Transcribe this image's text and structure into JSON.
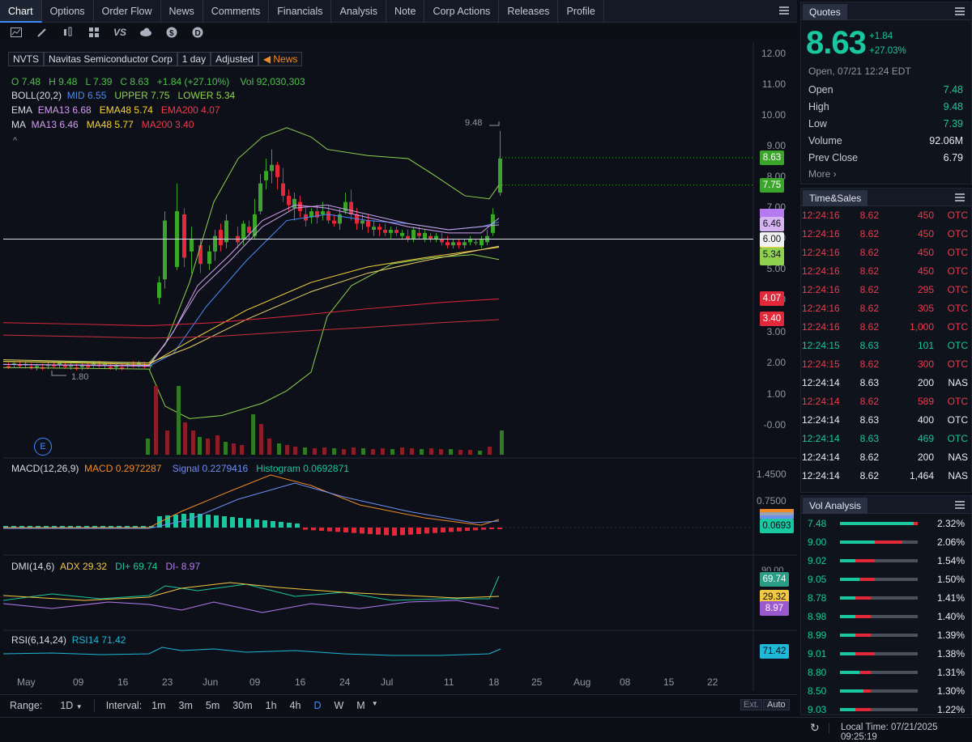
{
  "tabs": [
    "Chart",
    "Options",
    "Order Flow",
    "News",
    "Comments",
    "Financials",
    "Analysis",
    "Note",
    "Corp Actions",
    "Releases",
    "Profile"
  ],
  "toolbar_icons": [
    "line-chart-icon",
    "pen-icon",
    "candles-icon",
    "grid-icon",
    "compare-icon",
    "cloud-icon",
    "dollar-icon",
    "dividend-icon"
  ],
  "toolbar_vs": "VS",
  "header": {
    "symbol": "NVTS",
    "name": "Navitas Semiconductor Corp",
    "interval": "1 day",
    "adjust": "Adjusted",
    "news": "News"
  },
  "ohlc": {
    "o_label": "O",
    "o": "7.48",
    "h_label": "H",
    "h": "9.48",
    "l_label": "L",
    "l": "7.39",
    "c_label": "C",
    "c": "8.63",
    "chg": "+1.84 (+27.10%)",
    "vol_label": "Vol",
    "vol": "92,030,303"
  },
  "boll": {
    "name": "BOLL(20,2)",
    "mid": "MID 6.55",
    "upper": "UPPER 7.75",
    "lower": "LOWER 5.34"
  },
  "ema": {
    "name": "EMA",
    "e13": "EMA13 6.68",
    "e48": "EMA48 5.74",
    "e200": "EMA200 4.07"
  },
  "ma": {
    "name": "MA",
    "m13": "MA13 6.46",
    "m48": "MA48 5.77",
    "m200": "MA200 3.40"
  },
  "y_axis": [
    "12.00",
    "11.00",
    "10.00",
    "9.00",
    "8.00",
    "7.00",
    "6.00",
    "5.00",
    "4.00",
    "3.00",
    "2.00",
    "1.00",
    "-0.00"
  ],
  "price_labels": {
    "close": "8.63",
    "upper": "7.75",
    "ma13": "6.46",
    "cursor": "6.00",
    "lower": "5.34",
    "ema200": "4.07",
    "ma200": "3.40"
  },
  "high_marker": "9.48",
  "low_marker": "1.80",
  "earnings": "E",
  "macd": {
    "name": "MACD(12,26,9)",
    "macd": "MACD 0.2972287",
    "signal": "Signal 0.2279416",
    "hist": "Histogram 0.0692871",
    "axis": [
      "1.4500",
      "0.7500"
    ],
    "label": "0.0693"
  },
  "dmi": {
    "name": "DMI(14,6)",
    "adx": "ADX 29.32",
    "dip": "DI+ 69.74",
    "dim": "DI- 8.97",
    "lbl_dip": "69.74",
    "lbl_adx": "29.32",
    "lbl_dim": "8.97",
    "axis_top": "90.00"
  },
  "rsi": {
    "name": "RSI(6,14,24)",
    "rsi14": "RSI14 71.42",
    "lbl": "71.42"
  },
  "x_axis": [
    "May",
    "09",
    "16",
    "23",
    "Jun",
    "09",
    "16",
    "24",
    "Jul",
    "11",
    "18",
    "25",
    "Aug",
    "08",
    "15",
    "22"
  ],
  "bottom": {
    "range_label": "Range:",
    "range": "1D",
    "interval_label": "Interval:",
    "intervals": [
      "1m",
      "3m",
      "5m",
      "30m",
      "1h",
      "4h",
      "D",
      "W",
      "M"
    ],
    "ext": "Ext.",
    "auto": "Auto"
  },
  "status": {
    "local_time": "Local Time: 07/21/2025 09:25:19"
  },
  "quotes": {
    "title": "Quotes",
    "price": "8.63",
    "chg": "+1.84",
    "pct": "+27.03%",
    "time": "Open, 07/21 12:24 EDT",
    "rows": [
      [
        "Open",
        "7.48"
      ],
      [
        "High",
        "9.48"
      ],
      [
        "Low",
        "7.39"
      ],
      [
        "Volume",
        "92.06M"
      ],
      [
        "Prev Close",
        "6.79"
      ]
    ],
    "more": "More ›"
  },
  "timesales": {
    "title": "Time&Sales",
    "rows": [
      [
        "12:24:16",
        "8.62",
        "450",
        "OTC",
        "neg"
      ],
      [
        "12:24:16",
        "8.62",
        "450",
        "OTC",
        "neg"
      ],
      [
        "12:24:16",
        "8.62",
        "450",
        "OTC",
        "neg"
      ],
      [
        "12:24:16",
        "8.62",
        "450",
        "OTC",
        "neg"
      ],
      [
        "12:24:16",
        "8.62",
        "295",
        "OTC",
        "neg"
      ],
      [
        "12:24:16",
        "8.62",
        "305",
        "OTC",
        "neg"
      ],
      [
        "12:24:16",
        "8.62",
        "1,000",
        "OTC",
        "neg"
      ],
      [
        "12:24:15",
        "8.63",
        "101",
        "OTC",
        "pos"
      ],
      [
        "12:24:15",
        "8.62",
        "300",
        "OTC",
        "neg"
      ],
      [
        "12:24:14",
        "8.63",
        "200",
        "NAS",
        "wht"
      ],
      [
        "12:24:14",
        "8.62",
        "589",
        "OTC",
        "neg"
      ],
      [
        "12:24:14",
        "8.63",
        "400",
        "OTC",
        "wht"
      ],
      [
        "12:24:14",
        "8.63",
        "469",
        "OTC",
        "pos"
      ],
      [
        "12:24:14",
        "8.62",
        "200",
        "NAS",
        "wht"
      ],
      [
        "12:24:14",
        "8.62",
        "1,464",
        "NAS",
        "wht"
      ]
    ]
  },
  "volanalysis": {
    "title": "Vol Analysis",
    "rows": [
      [
        "7.48",
        "2.32%",
        0.95,
        0.05
      ],
      [
        "9.00",
        "2.06%",
        0.45,
        0.35
      ],
      [
        "9.02",
        "1.54%",
        0.2,
        0.25
      ],
      [
        "9.05",
        "1.50%",
        0.25,
        0.2
      ],
      [
        "8.78",
        "1.41%",
        0.2,
        0.2
      ],
      [
        "8.98",
        "1.40%",
        0.2,
        0.2
      ],
      [
        "8.99",
        "1.39%",
        0.2,
        0.2
      ],
      [
        "9.01",
        "1.38%",
        0.2,
        0.25
      ],
      [
        "8.80",
        "1.31%",
        0.25,
        0.15
      ],
      [
        "8.50",
        "1.30%",
        0.3,
        0.1
      ],
      [
        "9.03",
        "1.22%",
        0.2,
        0.2
      ]
    ]
  }
}
